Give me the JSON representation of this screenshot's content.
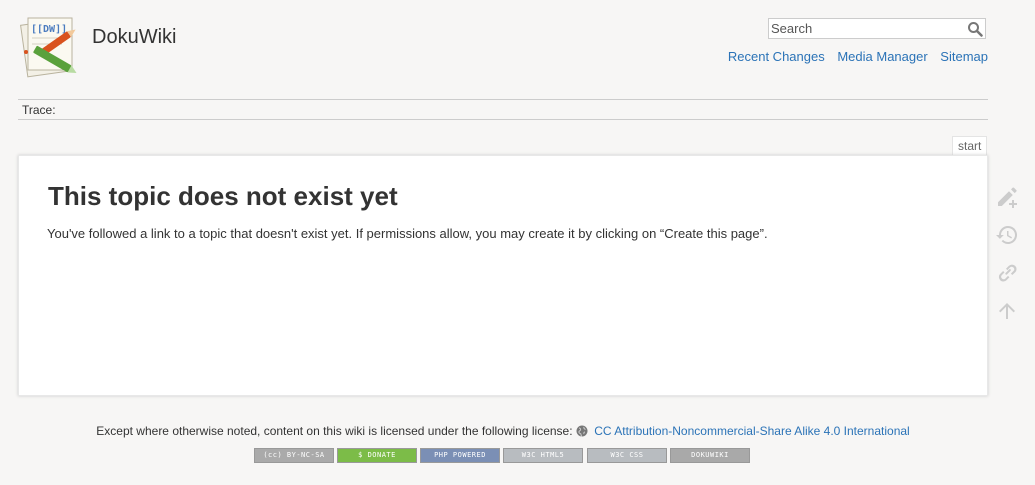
{
  "header": {
    "site_title": "DokuWiki",
    "search_placeholder": "Search",
    "tools": [
      "Recent Changes",
      "Media Manager",
      "Sitemap"
    ]
  },
  "breadcrumb": {
    "label": "Trace:"
  },
  "page": {
    "id": "start",
    "heading": "This topic does not exist yet",
    "message": "You've followed a link to a topic that doesn't exist yet. If permissions allow, you may create it by clicking on “Create this page”."
  },
  "page_tools": [
    "edit-icon",
    "history-icon",
    "backlinks-icon",
    "back-to-top-icon"
  ],
  "footer": {
    "license_prefix": "Except where otherwise noted, content on this wiki is licensed under the following license:",
    "license_link": "CC Attribution-Noncommercial-Share Alike 4.0 International",
    "buttons": [
      "(cc) BY-NC-SA",
      "$ DONATE",
      "PHP POWERED",
      "W3C HTML5",
      "W3C CSS",
      "DOKUWIKI"
    ]
  },
  "colors": {
    "link": "#2b73b7",
    "background": "#f7f6f5",
    "text": "#333333"
  }
}
